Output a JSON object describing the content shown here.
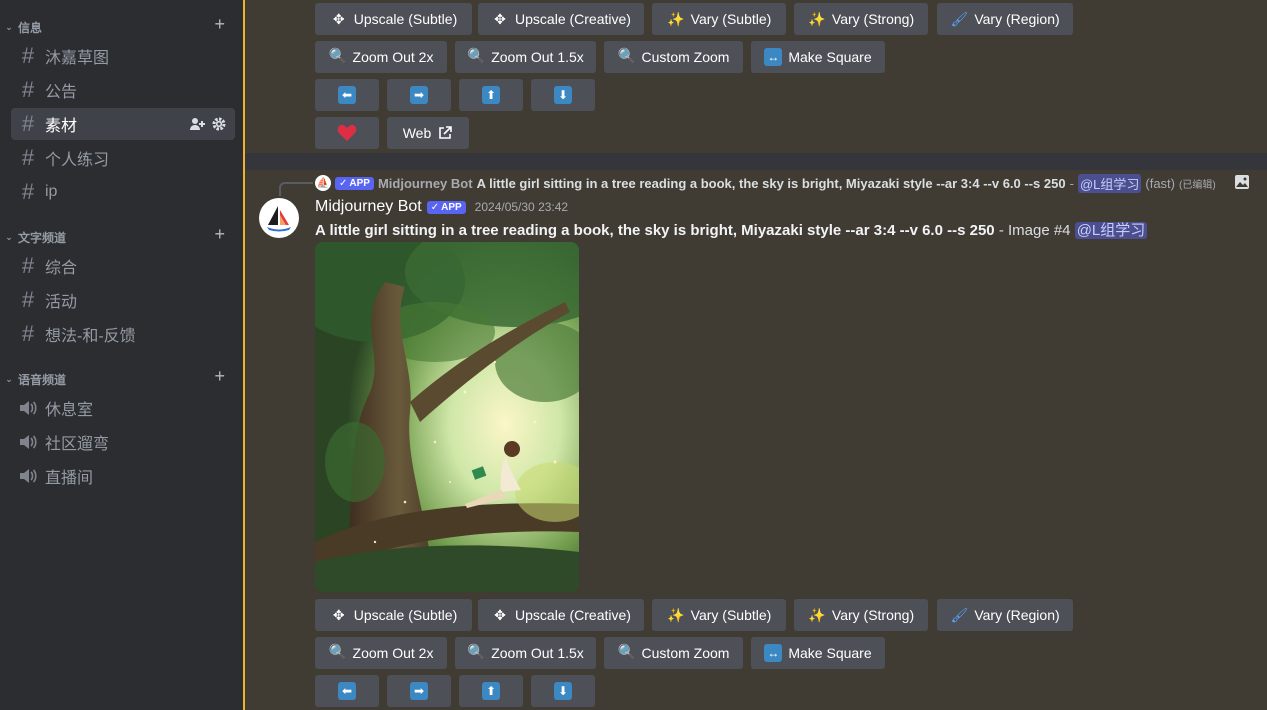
{
  "sidebar": {
    "categories": [
      {
        "label": "信息"
      },
      {
        "label": "文字频道"
      },
      {
        "label": "语音频道"
      }
    ],
    "info_channels": [
      {
        "label": "沐嘉草图"
      },
      {
        "label": "公告"
      },
      {
        "label": "素材"
      },
      {
        "label": "个人练习"
      },
      {
        "label": "ip"
      }
    ],
    "text_channels": [
      {
        "label": "综合"
      },
      {
        "label": "活动"
      },
      {
        "label": "想法-和-反馈"
      }
    ],
    "voice_channels": [
      {
        "label": "休息室"
      },
      {
        "label": "社区遛弯"
      },
      {
        "label": "直播间"
      }
    ]
  },
  "buttons": {
    "upscale_subtle": "Upscale (Subtle)",
    "upscale_creative": "Upscale (Creative)",
    "vary_subtle": "Vary (Subtle)",
    "vary_strong": "Vary (Strong)",
    "vary_region": "Vary (Region)",
    "zoom_out_2x": "Zoom Out 2x",
    "zoom_out_15x": "Zoom Out 1.5x",
    "custom_zoom": "Custom Zoom",
    "make_square": "Make Square",
    "web": "Web"
  },
  "reply": {
    "author": "Midjourney Bot",
    "badge": "APP",
    "prompt": "A little girl sitting in a tree reading a book, the sky is bright, Miyazaki style --ar 3:4 --v 6.0 --s 250",
    "dash": "-",
    "mention": "@L组学习",
    "speed": "(fast)",
    "edited": "(已编辑)"
  },
  "message": {
    "author": "Midjourney Bot",
    "badge": "APP",
    "timestamp": "2024/05/30 23:42",
    "prompt": "A little girl sitting in a tree reading a book, the sky is bright, Miyazaki style --ar 3:4 --v 6.0 --s 250",
    "suffix": "- Image #4",
    "mention": "@L组学习"
  },
  "colors": {
    "accent_gold": "#f0b232",
    "button_gray": "#4e5058",
    "badge_blurple": "#5865f2",
    "heart_red": "#dd2e44"
  }
}
